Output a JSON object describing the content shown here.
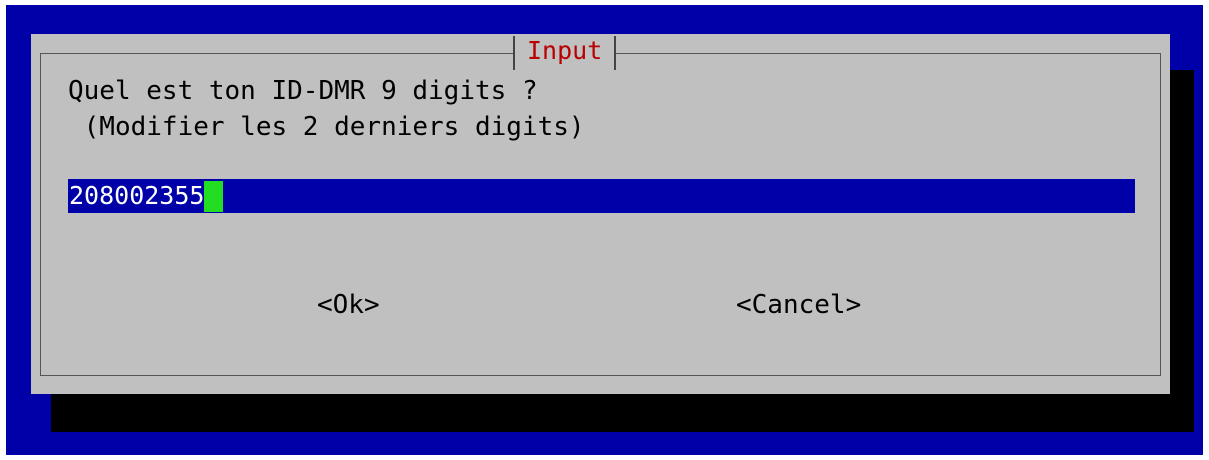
{
  "dialog": {
    "title": "Input",
    "prompt_line1": "Quel est ton ID-DMR 9 digits ?",
    "prompt_line2": " (Modifier les 2 derniers digits)",
    "input_value": "208002355",
    "ok_label": "<Ok>",
    "cancel_label": "<Cancel>"
  },
  "colors": {
    "screen_background": "#0000a8",
    "dialog_background": "#c0c0c0",
    "title_text": "#b80000",
    "input_background": "#0000a8",
    "input_text": "#ffffff",
    "cursor": "#22dd22",
    "shadow": "#000000"
  }
}
